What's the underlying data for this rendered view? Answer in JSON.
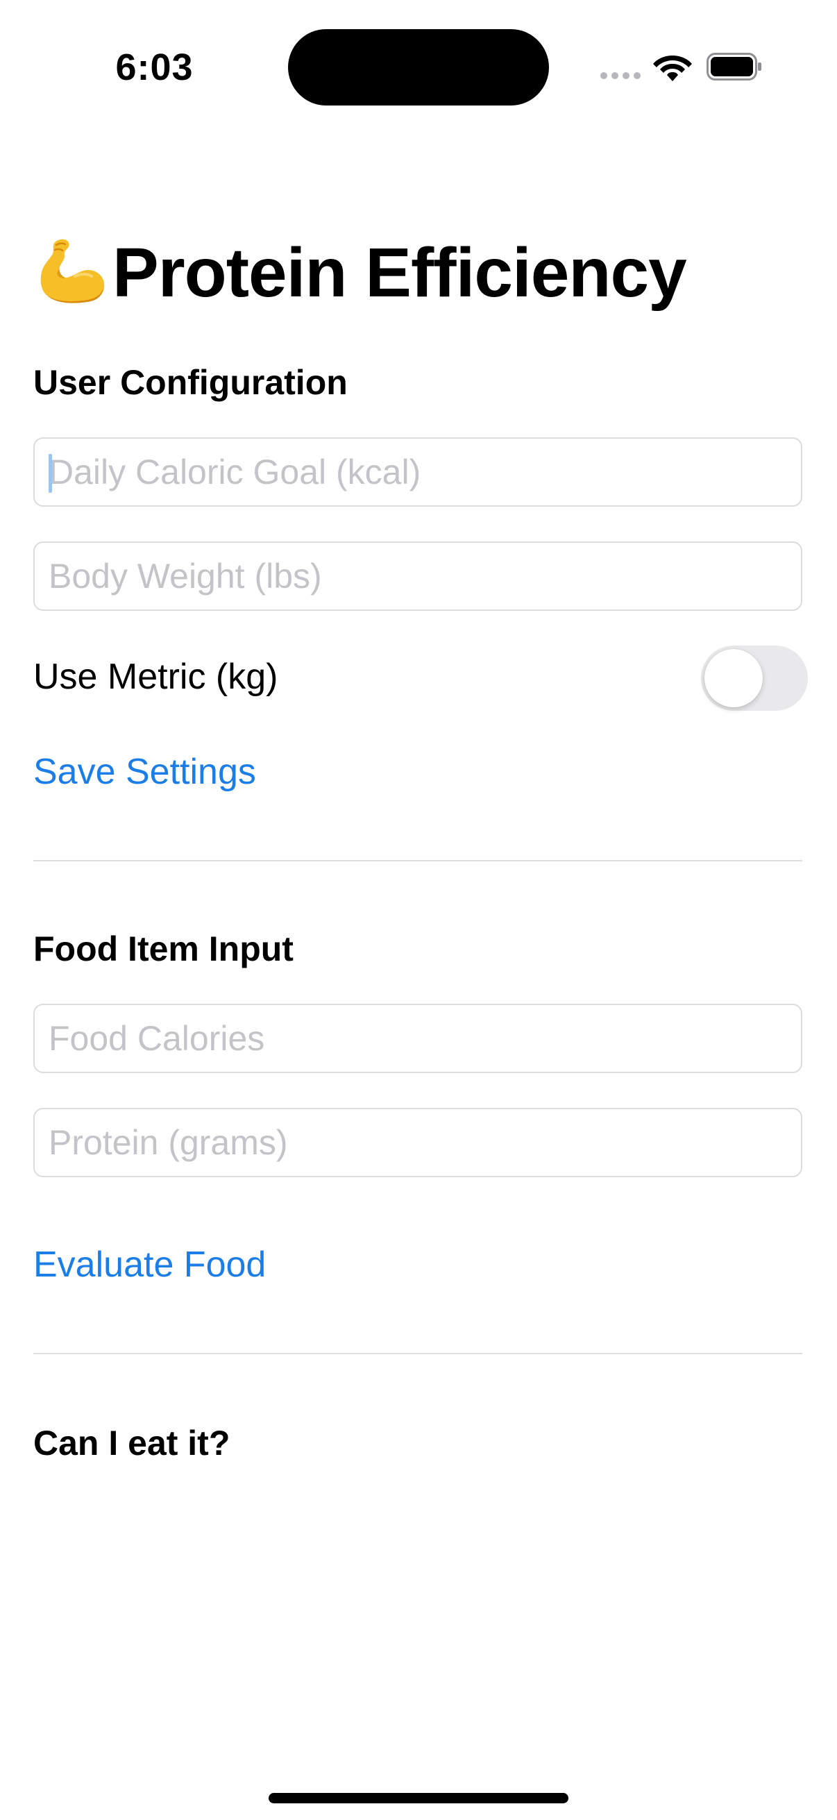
{
  "status_bar": {
    "time": "6:03"
  },
  "page": {
    "title": "Protein Efficiency",
    "title_icon": "flexed-biceps-emoji"
  },
  "user_config": {
    "heading": "User Configuration",
    "caloric_goal_placeholder": "Daily Caloric Goal (kcal)",
    "caloric_goal_value": "",
    "body_weight_placeholder": "Body Weight (lbs)",
    "body_weight_value": "",
    "metric_label": "Use Metric (kg)",
    "metric_enabled": false,
    "save_label": "Save Settings"
  },
  "food_input": {
    "heading": "Food Item Input",
    "calories_placeholder": "Food Calories",
    "calories_value": "",
    "protein_placeholder": "Protein (grams)",
    "protein_value": "",
    "evaluate_label": "Evaluate Food"
  },
  "result": {
    "heading": "Can I eat it?"
  },
  "colors": {
    "accent": "#1b7ee8",
    "placeholder": "#c4c4c8",
    "field_border": "#dcdce0",
    "toggle_off": "#e9e9eb",
    "divider": "#e0e0e4"
  }
}
